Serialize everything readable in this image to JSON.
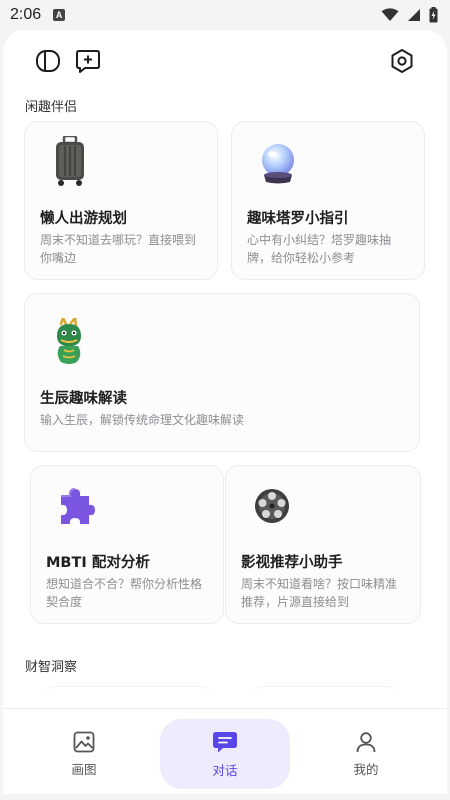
{
  "status_bar": {
    "time": "2:06",
    "notification_badge": "A",
    "icons": [
      "wifi-icon",
      "signal-icon",
      "battery-charging-icon"
    ]
  },
  "topbar": {
    "icons": [
      "sidebar-toggle-icon",
      "new-chat-icon",
      "settings-hexagon-icon"
    ]
  },
  "sections": {
    "leisure_title": "闲趣伴侣",
    "finance_title": "财智洞察"
  },
  "cards": [
    {
      "id": "lazy-trip",
      "title": "懒人出游规划",
      "desc": [
        "周末不知道去哪玩？直接喂到",
        "你嘴边"
      ],
      "icon": "suitcase-icon"
    },
    {
      "id": "tarot",
      "title": "趣味塔罗小指引",
      "desc": [
        "心中有小纠结？塔罗趣味抽",
        "牌，给你轻松小参考"
      ],
      "icon": "crystal-ball-icon"
    },
    {
      "id": "birth",
      "title": "生辰趣味解读",
      "desc": [
        "输入生辰，解锁传统命理文化趣味解读"
      ],
      "icon": "dragon-icon"
    },
    {
      "id": "mbti",
      "title": "MBTI 配对分析",
      "desc": [
        "想知道合不合？帮你分析性格",
        "契合度"
      ],
      "icon": "puzzle-piece-icon"
    },
    {
      "id": "movie",
      "title": "影视推荐小助手",
      "desc": [
        "周末不知道看啥？按口味精准",
        "推荐，片源直接给到"
      ],
      "icon": "film-reel-icon"
    }
  ],
  "bottom_nav": {
    "items": [
      {
        "label": "画图",
        "icon": "image-icon",
        "active": false
      },
      {
        "label": "对话",
        "icon": "chat-bubble-icon",
        "active": true
      },
      {
        "label": "我的",
        "icon": "user-icon",
        "active": false
      }
    ]
  },
  "colors": {
    "accent": "#5a45e8",
    "active_nav_bg": "#eeebfd",
    "page_bg": "#f4f4f6",
    "card_bg": "#fcfcfd"
  }
}
